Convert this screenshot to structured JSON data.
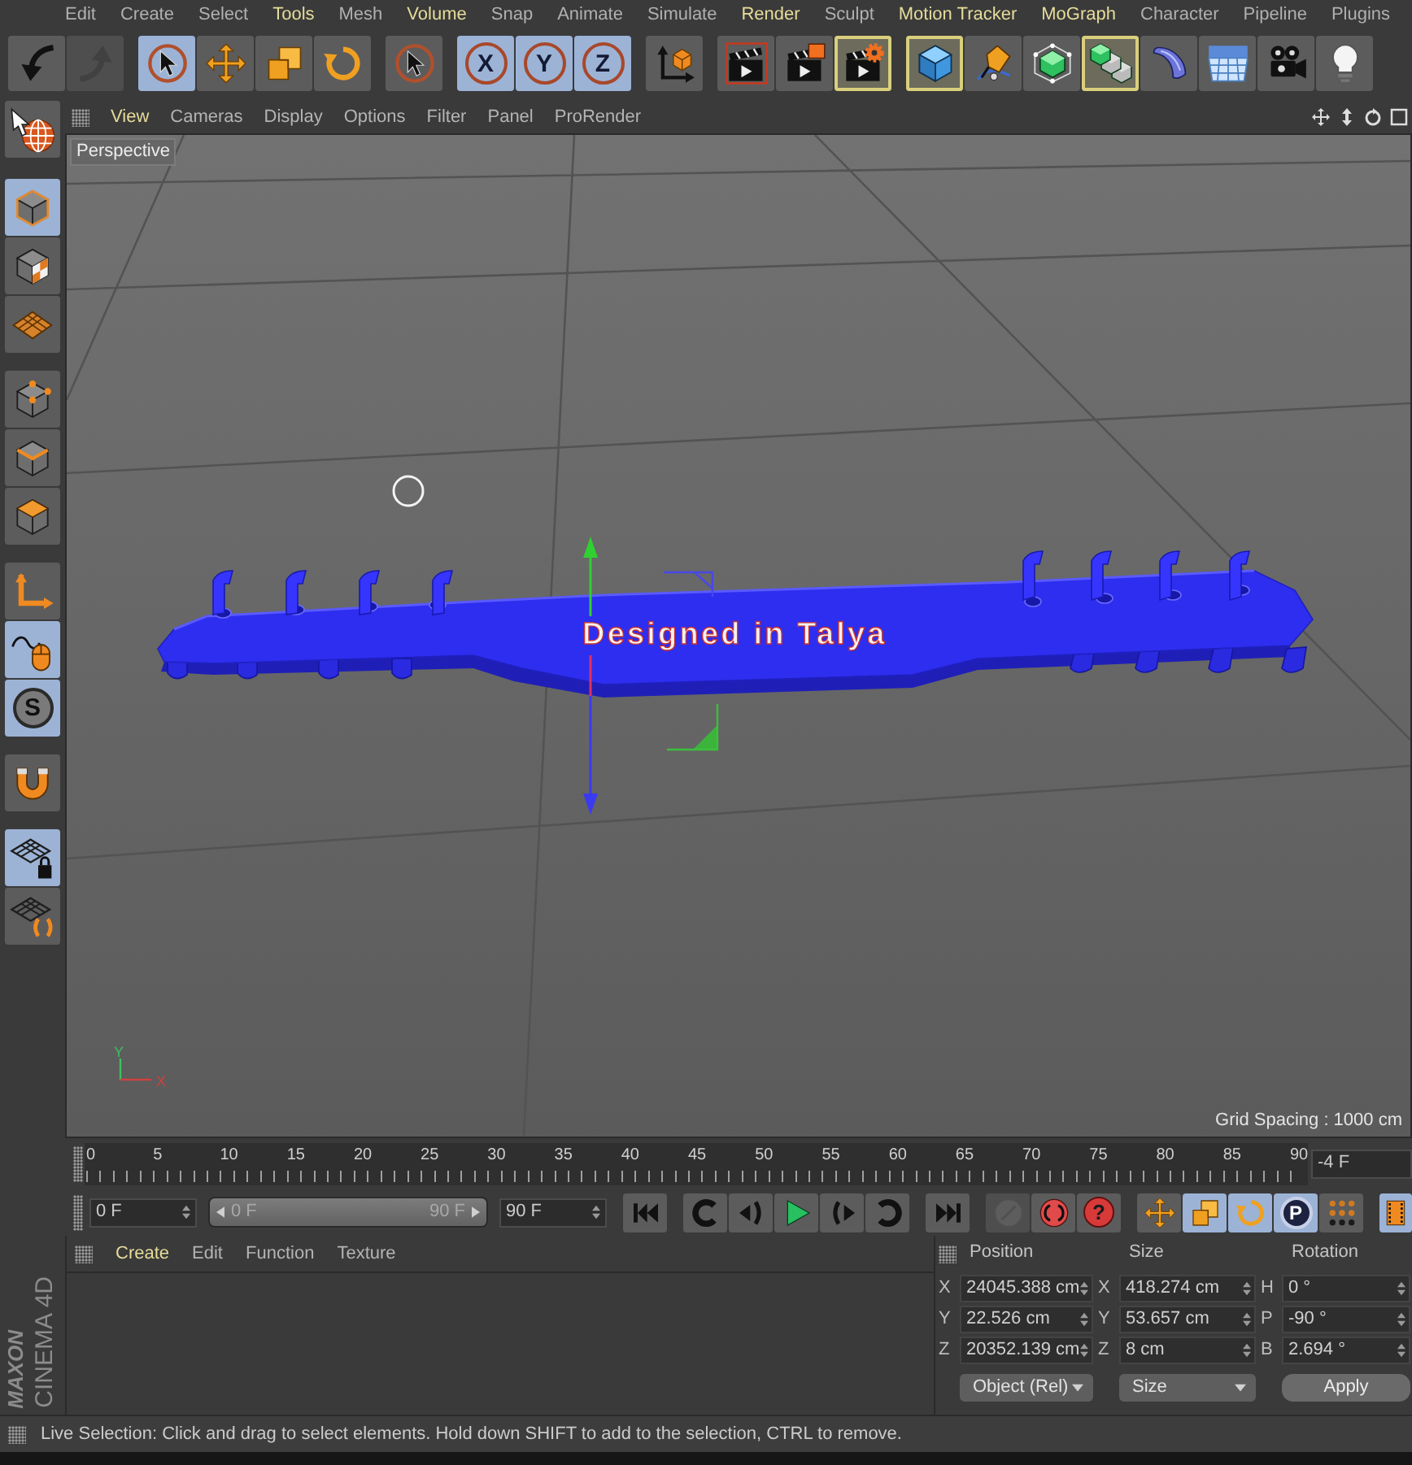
{
  "menu_bar": [
    {
      "label": "Edit",
      "highlighted": false
    },
    {
      "label": "Create",
      "highlighted": false
    },
    {
      "label": "Select",
      "highlighted": false
    },
    {
      "label": "Tools",
      "highlighted": true
    },
    {
      "label": "Mesh",
      "highlighted": false
    },
    {
      "label": "Volume",
      "highlighted": true
    },
    {
      "label": "Snap",
      "highlighted": false
    },
    {
      "label": "Animate",
      "highlighted": false
    },
    {
      "label": "Simulate",
      "highlighted": false
    },
    {
      "label": "Render",
      "highlighted": true
    },
    {
      "label": "Sculpt",
      "highlighted": false
    },
    {
      "label": "Motion Tracker",
      "highlighted": true
    },
    {
      "label": "MoGraph",
      "highlighted": true
    },
    {
      "label": "Character",
      "highlighted": false
    },
    {
      "label": "Pipeline",
      "highlighted": false
    },
    {
      "label": "Plugins",
      "highlighted": false
    }
  ],
  "toolbar": [
    {
      "tools": [
        {
          "kind": "undo",
          "disabled": false
        },
        {
          "kind": "redo",
          "disabled": true
        }
      ]
    },
    {
      "tools": [
        {
          "kind": "live-selection",
          "selected": true
        },
        {
          "kind": "move",
          "selected": false
        },
        {
          "kind": "scale",
          "selected": false
        },
        {
          "kind": "rotate",
          "selected": false
        }
      ]
    },
    {
      "tools": [
        {
          "kind": "recent-tool",
          "selected": false
        }
      ]
    },
    {
      "tools": [
        {
          "kind": "axis-lock",
          "label": "X",
          "selected": true
        },
        {
          "kind": "axis-lock",
          "label": "Y",
          "selected": true
        },
        {
          "kind": "axis-lock",
          "label": "Z",
          "selected": true
        }
      ]
    },
    {
      "tools": [
        {
          "kind": "coordinate-system",
          "selected": false
        }
      ]
    },
    {
      "tools": [
        {
          "kind": "render-view",
          "highlighted": false
        },
        {
          "kind": "render-picture-viewer",
          "highlighted": false
        },
        {
          "kind": "render-settings",
          "highlighted": true
        }
      ]
    },
    {
      "tools": [
        {
          "kind": "cube",
          "highlighted": true
        },
        {
          "kind": "pen",
          "highlighted": false
        },
        {
          "kind": "subdivision-surface",
          "highlighted": false
        },
        {
          "kind": "cloner",
          "highlighted": true
        },
        {
          "kind": "bend",
          "highlighted": false
        },
        {
          "kind": "floor",
          "highlighted": false
        },
        {
          "kind": "camera",
          "highlighted": false
        },
        {
          "kind": "light",
          "highlighted": false
        }
      ]
    }
  ],
  "left_toolbar": [
    {
      "tools": [
        {
          "kind": "globe",
          "selected": false
        }
      ]
    },
    {
      "tools": [
        {
          "kind": "model-mode",
          "selected": true
        },
        {
          "kind": "texture-mode",
          "selected": false
        },
        {
          "kind": "workplane-mode",
          "selected": false
        }
      ]
    },
    {
      "tools": [
        {
          "kind": "points-mode",
          "selected": false
        },
        {
          "kind": "edges-mode",
          "selected": false
        },
        {
          "kind": "polygons-mode",
          "selected": false
        }
      ]
    },
    {
      "tools": [
        {
          "kind": "axis-mode",
          "selected": false
        },
        {
          "kind": "tweak-mode",
          "selected": true
        },
        {
          "kind": "solo",
          "label": "S",
          "selected": true
        }
      ]
    },
    {
      "tools": [
        {
          "kind": "snap",
          "selected": false
        }
      ]
    },
    {
      "tools": [
        {
          "kind": "locked-workplane",
          "selected": true
        },
        {
          "kind": "planar-workplane",
          "selected": false
        }
      ]
    }
  ],
  "viewport": {
    "menu": [
      {
        "label": "View",
        "highlighted": true
      },
      {
        "label": "Cameras",
        "highlighted": false
      },
      {
        "label": "Display",
        "highlighted": false
      },
      {
        "label": "Options",
        "highlighted": false
      },
      {
        "label": "Filter",
        "highlighted": false
      },
      {
        "label": "Panel",
        "highlighted": false
      },
      {
        "label": "ProRender",
        "highlighted": false
      }
    ],
    "camera_label": "Perspective",
    "model_text": "Designed in Talya",
    "axis_labels": {
      "y": "Y",
      "x": "X"
    },
    "grid_spacing": "Grid Spacing : 1000 cm"
  },
  "timeline": {
    "ruler_labels": [
      "0",
      "5",
      "10",
      "15",
      "20",
      "25",
      "30",
      "35",
      "40",
      "45",
      "50",
      "55",
      "60",
      "65",
      "70",
      "75",
      "80",
      "85",
      "90"
    ],
    "current_frame": "-4 F"
  },
  "playback": {
    "start_frame": "0 F",
    "preview_range": {
      "start": "0 F",
      "end": "90 F",
      "level": 1
    },
    "end_frame": "90 F",
    "controls": [
      {
        "tools": [
          {
            "kind": "go-to-start"
          }
        ]
      },
      {
        "tools": [
          {
            "kind": "previous-key"
          },
          {
            "kind": "previous-frame"
          },
          {
            "kind": "play"
          },
          {
            "kind": "next-frame"
          },
          {
            "kind": "next-key"
          }
        ]
      },
      {
        "tools": [
          {
            "kind": "go-to-end"
          }
        ]
      },
      {
        "tools": [
          {
            "kind": "record-active",
            "disabled": true
          },
          {
            "kind": "autokey",
            "disabled": false
          },
          {
            "kind": "keyframe-selection",
            "label": "?",
            "disabled": false
          }
        ]
      },
      {
        "tools": [
          {
            "kind": "position-key",
            "selected": false
          },
          {
            "kind": "scale-key",
            "selected": true
          },
          {
            "kind": "rotation-key",
            "selected": true
          },
          {
            "kind": "parameter-key",
            "label": "P",
            "selected": true
          },
          {
            "kind": "point-level",
            "selected": false
          }
        ]
      },
      {
        "tools": [
          {
            "kind": "timeline-view",
            "selected": true
          }
        ]
      }
    ]
  },
  "logo": {
    "brand": "MAXON",
    "product": "CINEMA 4D"
  },
  "material_manager": {
    "menu": [
      {
        "label": "Create",
        "highlighted": true
      },
      {
        "label": "Edit",
        "highlighted": false
      },
      {
        "label": "Function",
        "highlighted": false
      },
      {
        "label": "Texture",
        "highlighted": false
      }
    ]
  },
  "coordinates": {
    "headings": [
      "Position",
      "Size",
      "Rotation"
    ],
    "rows": [
      {
        "position_axis": "X",
        "position": "24045.388 cm",
        "size_axis": "X",
        "size": "418.274 cm",
        "rotation_axis": "H",
        "rotation": "0 °"
      },
      {
        "position_axis": "Y",
        "position": "22.526 cm",
        "size_axis": "Y",
        "size": "53.657 cm",
        "rotation_axis": "P",
        "rotation": "-90 °"
      },
      {
        "position_axis": "Z",
        "position": "20352.139 cm",
        "size_axis": "Z",
        "size": "8 cm",
        "rotation_axis": "B",
        "rotation": "2.694 °"
      }
    ],
    "position_mode": "Object (Rel)",
    "size_mode": "Size",
    "apply_label": "Apply"
  },
  "status_bar": "Live Selection: Click and drag to select elements. Hold down SHIFT to add to the selection, CTRL to remove."
}
